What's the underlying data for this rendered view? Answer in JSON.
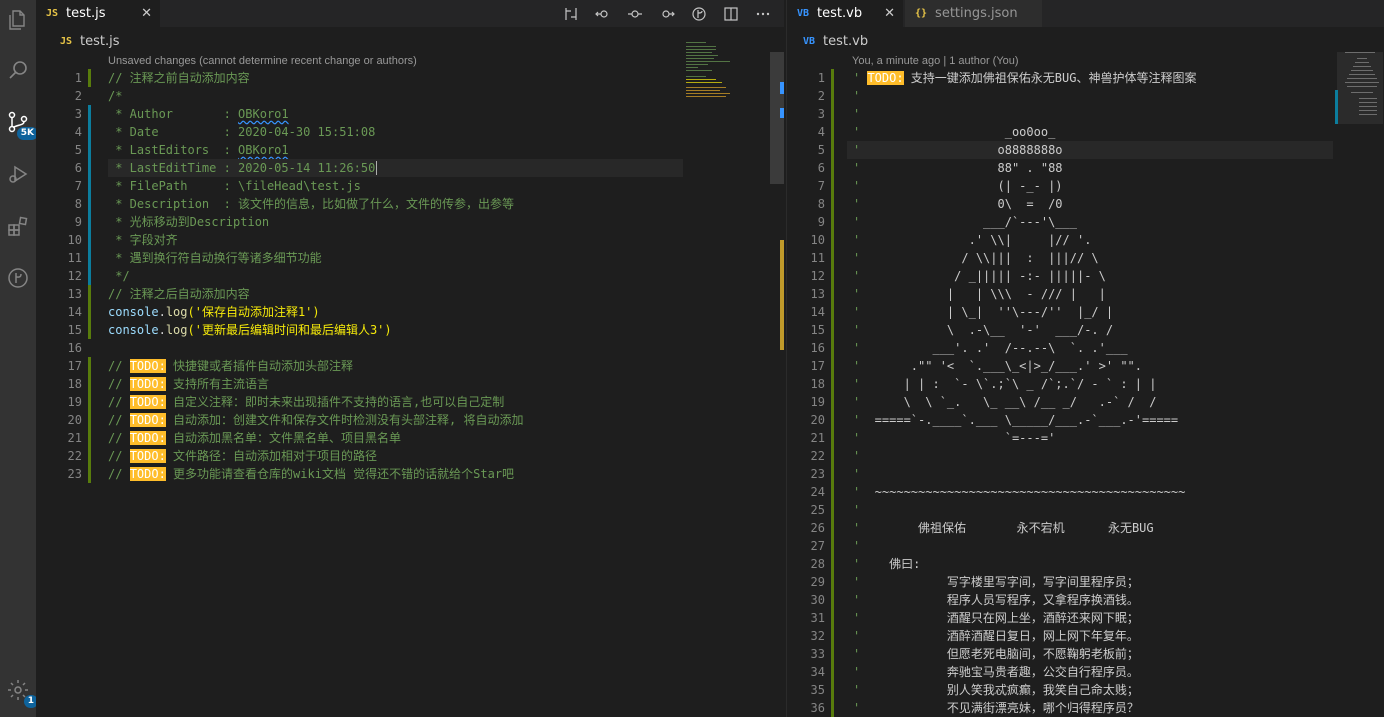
{
  "activity_bar": {
    "scm_badge": "5K",
    "settings_badge": "1"
  },
  "left": {
    "tabs": [
      {
        "icon": "JS",
        "label": "test.js",
        "close": "✕"
      }
    ],
    "breadcrumb": {
      "icon": "JS",
      "label": "test.js"
    },
    "codelens": "Unsaved changes (cannot determine recent change or authors)",
    "lines": [
      {
        "n": "1",
        "text": "// 注释之前自动添加内容"
      },
      {
        "n": "2",
        "text": "/*"
      },
      {
        "n": "3",
        "text": " * Author       : OBKoro1"
      },
      {
        "n": "4",
        "text": " * Date         : 2020-04-30 15:51:08"
      },
      {
        "n": "5",
        "text": " * LastEditors  : OBKoro1"
      },
      {
        "n": "6",
        "text": " * LastEditTime : 2020-05-14 11:26:50"
      },
      {
        "n": "7",
        "text": " * FilePath     : \\fileHead\\test.js"
      },
      {
        "n": "8",
        "text": " * Description  : 该文件的信息，比如做了什么，文件的传参，出参等"
      },
      {
        "n": "9",
        "text": " * 光标移动到Description"
      },
      {
        "n": "10",
        "text": " * 字段对齐"
      },
      {
        "n": "11",
        "text": " * 遇到换行符自动换行等诸多细节功能"
      },
      {
        "n": "12",
        "text": " */"
      },
      {
        "n": "13",
        "text": "// 注释之后自动添加内容"
      },
      {
        "n": "14",
        "obj": "console",
        "fn": "log",
        "str": "'保存自动添加注释1'"
      },
      {
        "n": "15",
        "obj": "console",
        "fn": "log",
        "str": "'更新最后编辑时间和最后编辑人3'"
      },
      {
        "n": "16",
        "text": ""
      },
      {
        "n": "17",
        "todo": "TODO:",
        "text": "快捷键或者插件自动添加头部注释"
      },
      {
        "n": "18",
        "todo": "TODO:",
        "text": "支持所有主流语言"
      },
      {
        "n": "19",
        "todo": "TODO:",
        "text": "自定义注释：即时未来出现插件不支持的语言,也可以自己定制"
      },
      {
        "n": "20",
        "todo": "TODO:",
        "text": "自动添加：创建文件和保存文件时检测没有头部注释, 将自动添加"
      },
      {
        "n": "21",
        "todo": "TODO:",
        "text": "自动添加黑名单：文件黑名单、项目黑名单"
      },
      {
        "n": "22",
        "todo": "TODO:",
        "text": "文件路径：自动添加相对于项目的路径"
      },
      {
        "n": "23",
        "todo": "TODO:",
        "text": "更多功能请查看仓库的wiki文档 觉得还不错的话就给个Star吧"
      }
    ]
  },
  "right": {
    "tabs": [
      {
        "icon": "VB",
        "label": "test.vb",
        "close": "✕"
      },
      {
        "icon": "{}",
        "label": "settings.json",
        "close": ""
      }
    ],
    "breadcrumb": {
      "icon": "VB",
      "label": "test.vb"
    },
    "codelens": "You, a minute ago | 1 author (You)",
    "lines": [
      {
        "n": "1",
        "todo": "TODO:",
        "text": "支持一键添加佛祖保佑永无BUG、神兽护体等注释图案"
      },
      {
        "n": "2",
        "text": ""
      },
      {
        "n": "3",
        "text": ""
      },
      {
        "n": "4",
        "text": "                   _oo0oo_"
      },
      {
        "n": "5",
        "text": "                  o8888888o"
      },
      {
        "n": "6",
        "text": "                  88\" . \"88"
      },
      {
        "n": "7",
        "text": "                  (| -_- |)"
      },
      {
        "n": "8",
        "text": "                  0\\  =  /0"
      },
      {
        "n": "9",
        "text": "                ___/`---'\\___"
      },
      {
        "n": "10",
        "text": "              .' \\\\|     |// '."
      },
      {
        "n": "11",
        "text": "             / \\\\|||  :  |||// \\"
      },
      {
        "n": "12",
        "text": "            / _||||| -:- |||||- \\"
      },
      {
        "n": "13",
        "text": "           |   | \\\\\\  - /// |   |"
      },
      {
        "n": "14",
        "text": "           | \\_|  ''\\---/''  |_/ |"
      },
      {
        "n": "15",
        "text": "           \\  .-\\__  '-'  ___/-. /"
      },
      {
        "n": "16",
        "text": "         ___'. .'  /--.--\\  `. .'___"
      },
      {
        "n": "17",
        "text": "      .\"\" '<  `.___\\_<|>_/___.' >' \"\"."
      },
      {
        "n": "18",
        "text": "     | | :  `- \\`.;`\\ _ /`;.`/ - ` : | |"
      },
      {
        "n": "19",
        "text": "     \\  \\ `_.   \\_ __\\ /__ _/   .-` /  /"
      },
      {
        "n": "20",
        "text": " =====`-.____`.___ \\_____/___.-`___.-'====="
      },
      {
        "n": "21",
        "text": "                   `=---='"
      },
      {
        "n": "22",
        "text": ""
      },
      {
        "n": "23",
        "text": ""
      },
      {
        "n": "24",
        "text": " ~~~~~~~~~~~~~~~~~~~~~~~~~~~~~~~~~~~~~~~~~~~"
      },
      {
        "n": "25",
        "text": ""
      },
      {
        "n": "26",
        "text": "       佛祖保佑       永不宕机      永无BUG"
      },
      {
        "n": "27",
        "text": ""
      },
      {
        "n": "28",
        "text": "   佛曰:"
      },
      {
        "n": "29",
        "text": "           写字楼里写字间，写字间里程序员；"
      },
      {
        "n": "30",
        "text": "           程序人员写程序，又拿程序换酒钱。"
      },
      {
        "n": "31",
        "text": "           酒醒只在网上坐，酒醉还来网下眠；"
      },
      {
        "n": "32",
        "text": "           酒醉酒醒日复日，网上网下年复年。"
      },
      {
        "n": "33",
        "text": "           但愿老死电脑间，不愿鞠躬老板前；"
      },
      {
        "n": "34",
        "text": "           奔驰宝马贵者趣，公交自行程序员。"
      },
      {
        "n": "35",
        "text": "           别人笑我忒疯癫，我笑自己命太贱；"
      },
      {
        "n": "36",
        "text": "           不见满街漂亮妹，哪个归得程序员？"
      }
    ]
  },
  "colors": {
    "accent": "#0e639c",
    "todo_bg": "#ffbd2a",
    "comment": "#6a9955",
    "string": "#f5e90a"
  }
}
